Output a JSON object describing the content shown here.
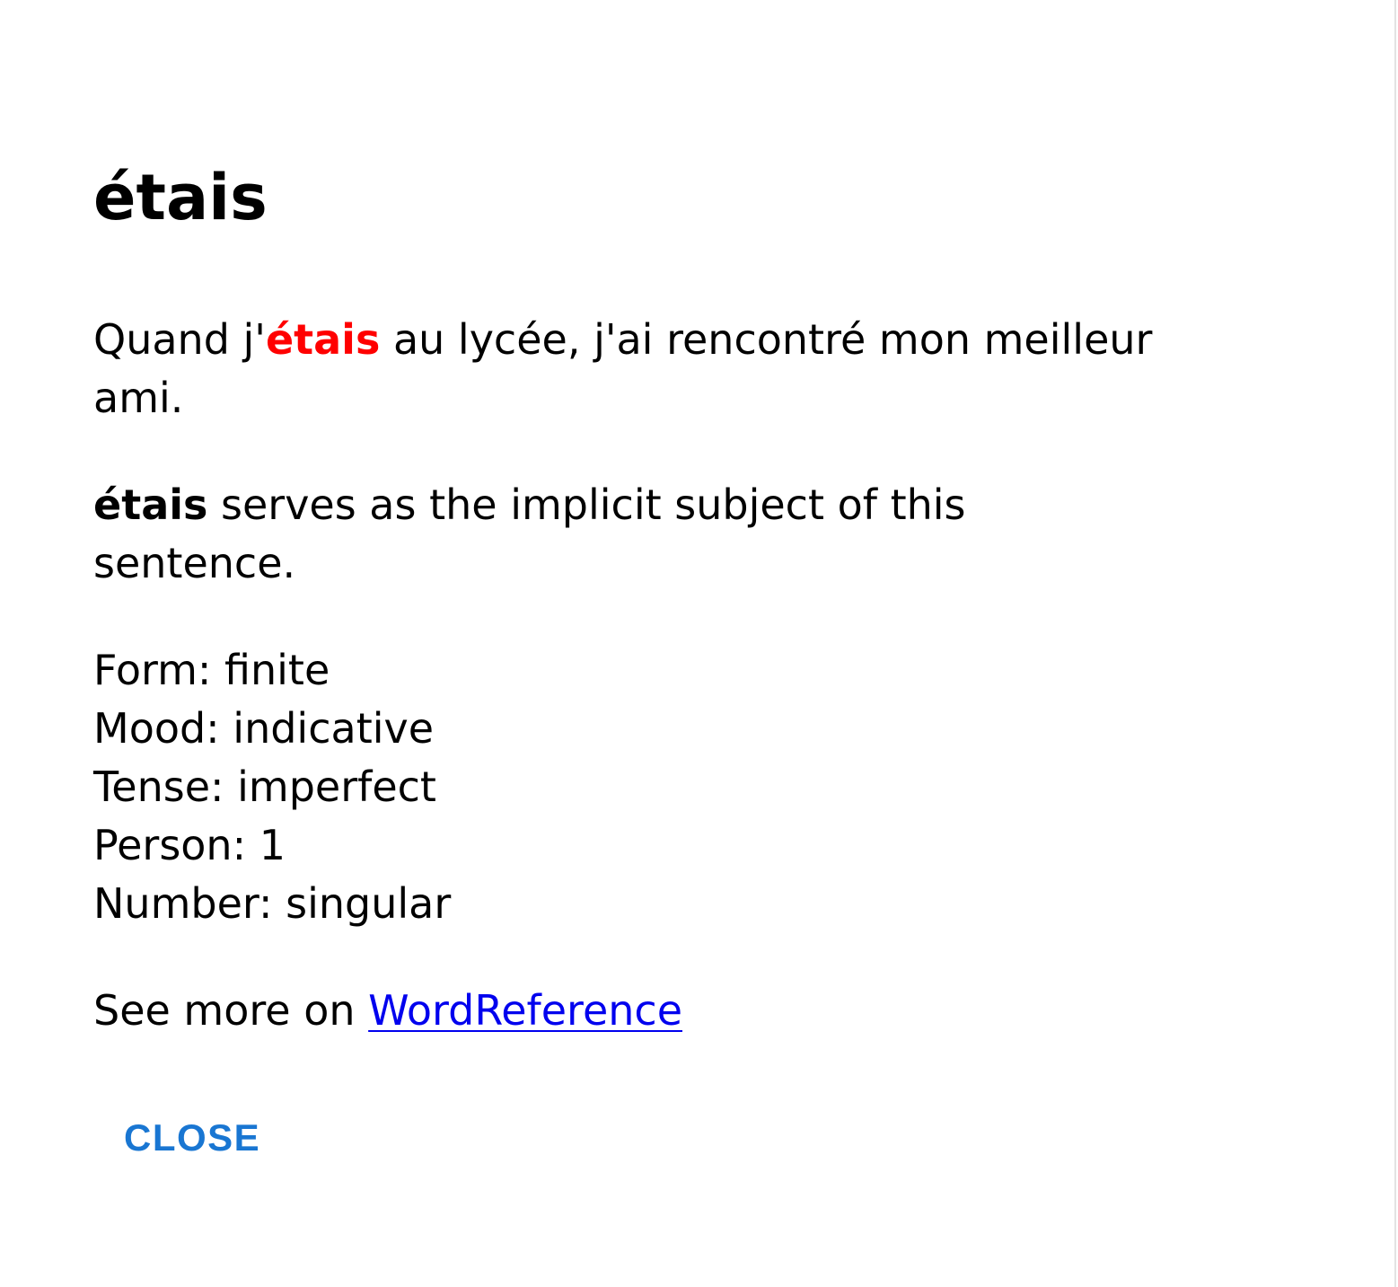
{
  "dialog": {
    "title": "étais",
    "sentence": {
      "before": "Quand j'",
      "highlight": "étais",
      "after": " au lycée, j'ai rencontré mon meilleur ami."
    },
    "role": {
      "word": "étais",
      "text": " serves as the implicit subject of this sentence."
    },
    "features": [
      "Form: finite",
      "Mood: indicative",
      "Tense: imperfect",
      "Person: 1",
      "Number: singular"
    ],
    "see_more": {
      "prefix": "See more on ",
      "link_label": "WordReference"
    },
    "close_label": "CLOSE"
  },
  "colors": {
    "highlight": "#ff0000",
    "link": "#0000ee",
    "close_button": "#1976d2"
  }
}
